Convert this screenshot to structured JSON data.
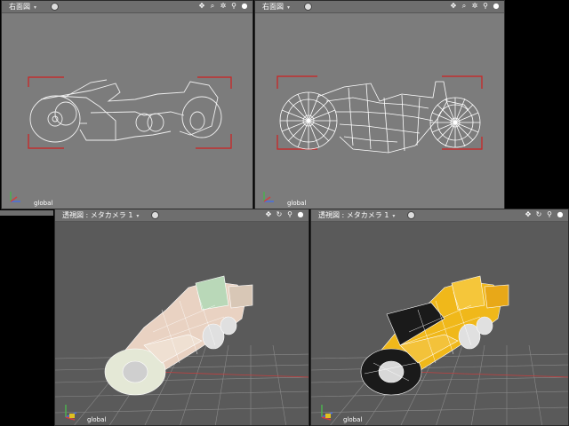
{
  "viewports": [
    {
      "title": "右面図",
      "dropdown": "▾",
      "axis_label": "global"
    },
    {
      "title": "右面図",
      "dropdown": "▾",
      "axis_label": "global"
    },
    {
      "title": "透視図 : メタカメラ 1",
      "dropdown": "▾",
      "axis_label": "global"
    },
    {
      "title": "透視図 : メタカメラ 1",
      "dropdown": "▾",
      "axis_label": "global"
    }
  ],
  "tool_icons": [
    "move-icon",
    "zoom-icon",
    "search-icon",
    "sphere-icon"
  ],
  "colors": {
    "ortho_bg": "#7c7c7c",
    "persp_bg": "#5a5a5a",
    "frame_red": "#d02020",
    "yellow_body": "#f0b81a",
    "wire": "#ffffff"
  }
}
